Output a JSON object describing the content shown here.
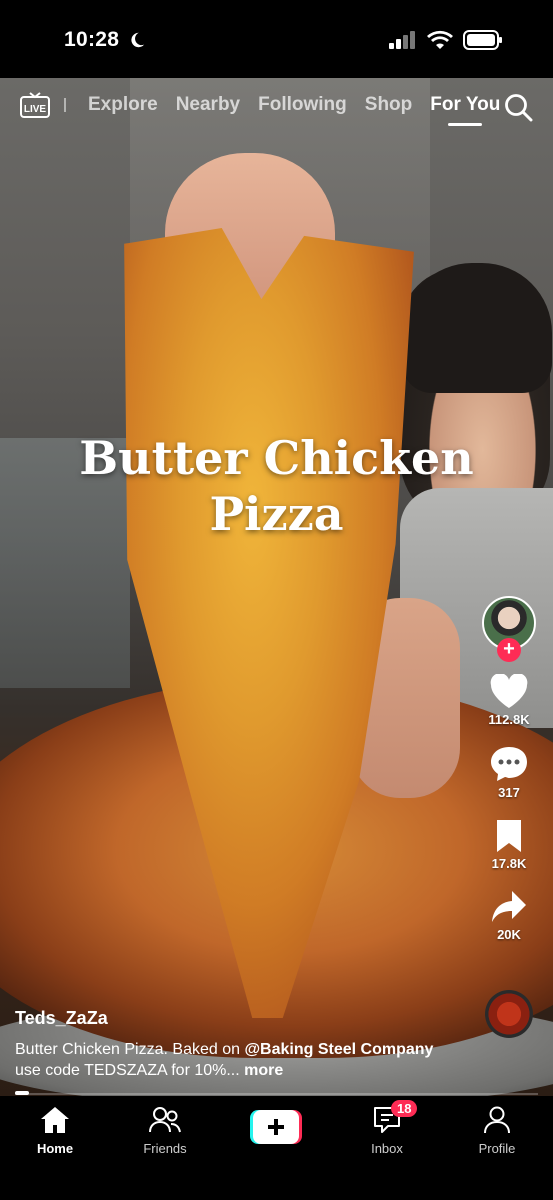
{
  "status": {
    "time": "10:28"
  },
  "topnav": {
    "live_label": "LIVE",
    "tabs": [
      {
        "label": "Explore"
      },
      {
        "label": "Nearby"
      },
      {
        "label": "Following"
      },
      {
        "label": "Shop"
      },
      {
        "label": "For You"
      }
    ]
  },
  "video": {
    "overlay_line1": "Butter Chicken",
    "overlay_line2": "Pizza"
  },
  "rail": {
    "likes": "112.8K",
    "comments": "317",
    "saves": "17.8K",
    "shares": "20K"
  },
  "caption": {
    "username": "Teds_ZaZa",
    "text_start": "Butter Chicken Pizza. Baked on ",
    "mention": "@Baking Steel Company",
    "text_end": " use code TEDSZAZA for 10%... ",
    "more": "more"
  },
  "bottomnav": {
    "home": "Home",
    "friends": "Friends",
    "inbox": "Inbox",
    "inbox_badge": "18",
    "profile": "Profile"
  },
  "colors": {
    "accent": "#fe2c55",
    "accent2": "#25f4ee"
  }
}
